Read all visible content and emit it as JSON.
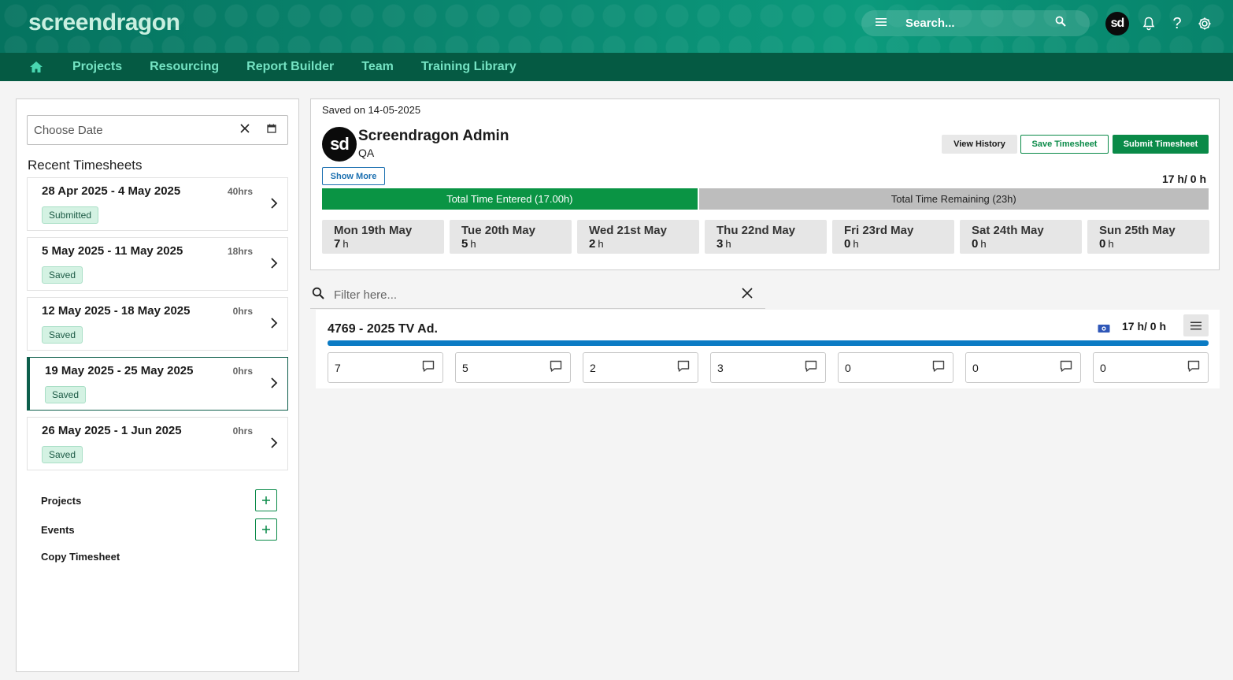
{
  "brand": {
    "logo_main": "screendragon",
    "avatar_initials": "sd"
  },
  "search": {
    "placeholder": "Search..."
  },
  "nav": {
    "items": [
      "Projects",
      "Resourcing",
      "Report Builder",
      "Team",
      "Training Library"
    ]
  },
  "date_picker": {
    "placeholder": "Choose Date"
  },
  "recent": {
    "title": "Recent Timesheets",
    "items": [
      {
        "range": "28 Apr 2025 - 4 May 2025",
        "hours": "40hrs",
        "status": "Submitted"
      },
      {
        "range": "5 May 2025 - 11 May 2025",
        "hours": "18hrs",
        "status": "Saved"
      },
      {
        "range": "12 May 2025 - 18 May 2025",
        "hours": "0hrs",
        "status": "Saved"
      },
      {
        "range": "19 May 2025 - 25 May 2025",
        "hours": "0hrs",
        "status": "Saved"
      },
      {
        "range": "26 May 2025 - 1 Jun 2025",
        "hours": "0hrs",
        "status": "Saved"
      }
    ],
    "active_index": 3
  },
  "side_actions": {
    "projects": "Projects",
    "events": "Events",
    "copy": "Copy Timesheet"
  },
  "header": {
    "saved_on": "Saved on 14-05-2025",
    "user_name": "Screendragon Admin",
    "user_role": "QA",
    "show_more": "Show More",
    "view_history": "View History",
    "save_timesheet": "Save Timesheet",
    "submit_timesheet": "Submit Timesheet",
    "total_hours": "17 h/ 0 h",
    "entered_label": "Total Time Entered (17.00h)",
    "remaining_label": "Total Time Remaining (23h)",
    "entered_fraction": 0.425
  },
  "days": [
    {
      "name": "Mon 19th May",
      "hours": "7",
      "unit": "h"
    },
    {
      "name": "Tue 20th May",
      "hours": "5",
      "unit": "h"
    },
    {
      "name": "Wed 21st May",
      "hours": "2",
      "unit": "h"
    },
    {
      "name": "Thu 22nd May",
      "hours": "3",
      "unit": "h"
    },
    {
      "name": "Fri 23rd May",
      "hours": "0",
      "unit": "h"
    },
    {
      "name": "Sat 24th May",
      "hours": "0",
      "unit": "h"
    },
    {
      "name": "Sun 25th May",
      "hours": "0",
      "unit": "h"
    }
  ],
  "filter": {
    "placeholder": "Filter here..."
  },
  "project": {
    "title": "4769 - 2025 TV Ad.",
    "hours": "17 h/ 0 h",
    "progress_fraction": 1.0,
    "entries": [
      "7",
      "5",
      "2",
      "3",
      "0",
      "0",
      "0"
    ]
  },
  "colors": {
    "brand_green": "#0a8a48",
    "nav_bg": "#055a43",
    "progress_blue": "#0b7bc4"
  }
}
